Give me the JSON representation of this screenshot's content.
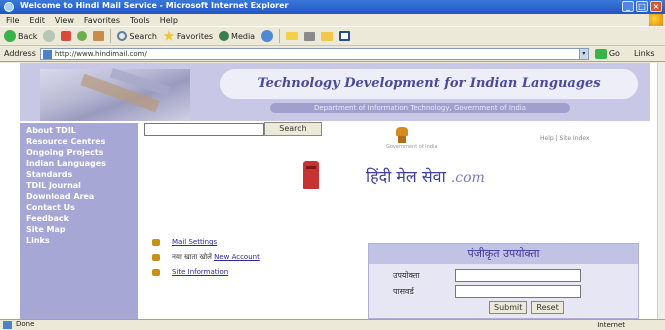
{
  "window": {
    "title": "Welcome to Hindi Mail Service - Microsoft Internet Explorer",
    "buttons": [
      "_",
      "□",
      "×"
    ]
  },
  "menu": [
    "File",
    "Edit",
    "View",
    "Favorites",
    "Tools",
    "Help"
  ],
  "toolbar": {
    "back": "Back",
    "search": "Search",
    "favorites": "Favorites",
    "media": "Media"
  },
  "address": {
    "label": "Address",
    "url": "http://www.hindimail.com/",
    "go": "Go",
    "links": "Links"
  },
  "banner": {
    "title": "Technology Development for Indian Languages",
    "subtitle": "Department of Information Technology, Government of India"
  },
  "nav": {
    "items": [
      "About TDIL",
      "Resource Centres",
      "Ongoing Projects",
      "Indian Languages",
      "Standards",
      "TDIL Journal",
      "Download Area",
      "Contact Us",
      "Feedback",
      "Site Map",
      "Links"
    ]
  },
  "search": {
    "button": "Search"
  },
  "header": {
    "emblem_caption": "Government of India",
    "top_links": "Help | Site Index"
  },
  "hindi_title": {
    "main": "हिंदी मेल सेवा",
    "suffix": ".com"
  },
  "bottom_links": [
    {
      "text": "Mail Settings",
      "type": "link"
    },
    {
      "text": "नया खाता खोलें",
      "type": "plain",
      "link": "New Account"
    },
    {
      "text": "Site Information",
      "type": "link"
    }
  ],
  "login": {
    "heading": "पंजीकृत उपयोक्ता",
    "user_label": "उपयोक्ता",
    "password_label": "पासवर्ड",
    "submit": "Submit",
    "reset": "Reset"
  },
  "status": {
    "text": "Done",
    "zone": "Internet"
  }
}
